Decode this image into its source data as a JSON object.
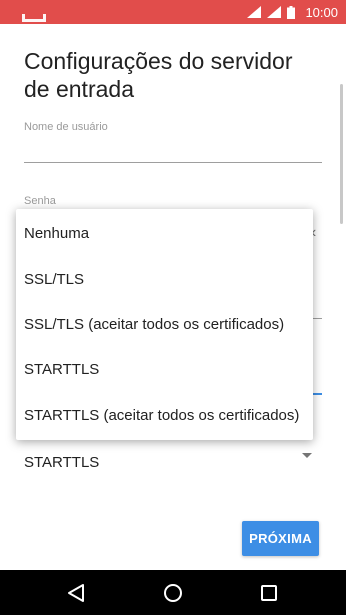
{
  "status_bar": {
    "time": "10:00",
    "color": "#e14d4b",
    "icons": [
      "wifi-icon",
      "signal-icon",
      "battery-icon"
    ]
  },
  "page": {
    "title": "Configurações do servidor de entrada"
  },
  "fields": {
    "username_label": "Nome de usuário",
    "username_value": "",
    "password_label": "Senha"
  },
  "dropdown": {
    "options": [
      "Nenhuma",
      "SSL/TLS",
      "SSL/TLS (aceitar todos os certificados)",
      "STARTTLS",
      "STARTTLS (aceitar todos os certificados)"
    ]
  },
  "security_select": {
    "selected": "STARTTLS"
  },
  "actions": {
    "next_label": "PRÓXIMA",
    "accent_color": "#3d8ee5"
  },
  "nav_bar": {
    "icons": [
      "back-icon",
      "home-icon",
      "recents-icon"
    ]
  }
}
